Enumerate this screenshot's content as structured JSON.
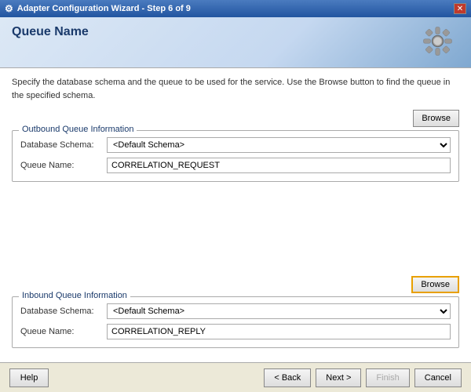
{
  "titlebar": {
    "title": "Adapter Configuration Wizard - Step 6 of 9",
    "close_label": "✕"
  },
  "header": {
    "title": "Queue Name",
    "description": "Specify the database schema and the queue to be used for the service. Use the Browse button to find the queue in the specified schema."
  },
  "outbound": {
    "legend": "Outbound Queue Information",
    "browse_label": "Browse",
    "db_schema_label": "Database Schema:",
    "db_schema_value": "<Default Schema>",
    "queue_name_label": "Queue Name:",
    "queue_name_value": "CORRELATION_REQUEST"
  },
  "inbound": {
    "legend": "Inbound Queue Information",
    "browse_label": "Browse",
    "db_schema_label": "Database Schema:",
    "db_schema_value": "<Default Schema>",
    "queue_name_label": "Queue Name:",
    "queue_name_value": "CORRELATION_REPLY"
  },
  "footer": {
    "help_label": "Help",
    "back_label": "< Back",
    "next_label": "Next >",
    "finish_label": "Finish",
    "cancel_label": "Cancel"
  }
}
